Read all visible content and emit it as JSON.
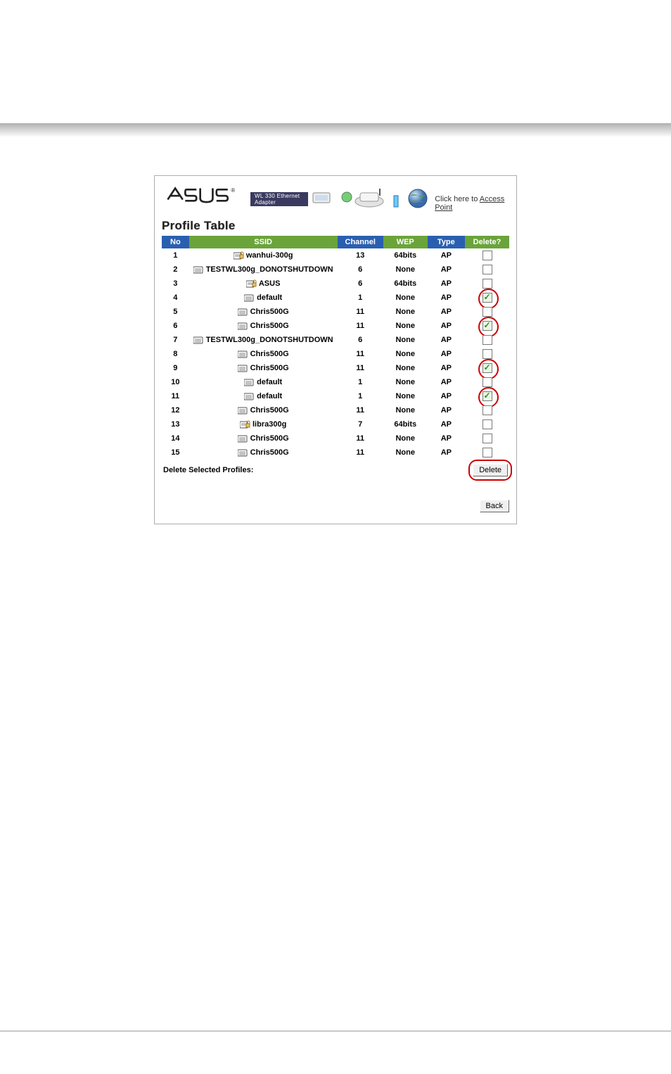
{
  "header": {
    "band_label": "WL 330 Ethernet Adapter",
    "ap_link_prefix": "Click here to ",
    "ap_link_text": "Access Point"
  },
  "profile_table": {
    "title": "Profile Table",
    "columns": {
      "no": "No",
      "ssid": "SSID",
      "channel": "Channel",
      "wep": "WEP",
      "type": "Type",
      "delete": "Delete?"
    },
    "rows": [
      {
        "no": 1,
        "ssid": "wanhui-300g",
        "icon": "locked",
        "channel": "13",
        "wep": "64bits",
        "type": "AP",
        "checked": false,
        "circled": false
      },
      {
        "no": 2,
        "ssid": "TESTWL300g_DONOTSHUTDOWN",
        "icon": "open",
        "channel": "6",
        "wep": "None",
        "type": "AP",
        "checked": false,
        "circled": false
      },
      {
        "no": 3,
        "ssid": "ASUS",
        "icon": "locked",
        "channel": "6",
        "wep": "64bits",
        "type": "AP",
        "checked": false,
        "circled": false
      },
      {
        "no": 4,
        "ssid": "default",
        "icon": "open",
        "channel": "1",
        "wep": "None",
        "type": "AP",
        "checked": true,
        "circled": true
      },
      {
        "no": 5,
        "ssid": "Chris500G",
        "icon": "open",
        "channel": "11",
        "wep": "None",
        "type": "AP",
        "checked": false,
        "circled": false
      },
      {
        "no": 6,
        "ssid": "Chris500G",
        "icon": "open",
        "channel": "11",
        "wep": "None",
        "type": "AP",
        "checked": true,
        "circled": true
      },
      {
        "no": 7,
        "ssid": "TESTWL300g_DONOTSHUTDOWN",
        "icon": "open",
        "channel": "6",
        "wep": "None",
        "type": "AP",
        "checked": false,
        "circled": false
      },
      {
        "no": 8,
        "ssid": "Chris500G",
        "icon": "open",
        "channel": "11",
        "wep": "None",
        "type": "AP",
        "checked": false,
        "circled": false
      },
      {
        "no": 9,
        "ssid": "Chris500G",
        "icon": "open",
        "channel": "11",
        "wep": "None",
        "type": "AP",
        "checked": true,
        "circled": true
      },
      {
        "no": 10,
        "ssid": "default",
        "icon": "open",
        "channel": "1",
        "wep": "None",
        "type": "AP",
        "checked": false,
        "circled": false
      },
      {
        "no": 11,
        "ssid": "default",
        "icon": "open",
        "channel": "1",
        "wep": "None",
        "type": "AP",
        "checked": true,
        "circled": true
      },
      {
        "no": 12,
        "ssid": "Chris500G",
        "icon": "open",
        "channel": "11",
        "wep": "None",
        "type": "AP",
        "checked": false,
        "circled": false
      },
      {
        "no": 13,
        "ssid": "libra300g",
        "icon": "locked",
        "channel": "7",
        "wep": "64bits",
        "type": "AP",
        "checked": false,
        "circled": false
      },
      {
        "no": 14,
        "ssid": "Chris500G",
        "icon": "open",
        "channel": "11",
        "wep": "None",
        "type": "AP",
        "checked": false,
        "circled": false
      },
      {
        "no": 15,
        "ssid": "Chris500G",
        "icon": "open",
        "channel": "11",
        "wep": "None",
        "type": "AP",
        "checked": false,
        "circled": false
      }
    ],
    "delete_label": "Delete Selected Profiles:",
    "delete_button": "Delete",
    "back_button": "Back"
  }
}
